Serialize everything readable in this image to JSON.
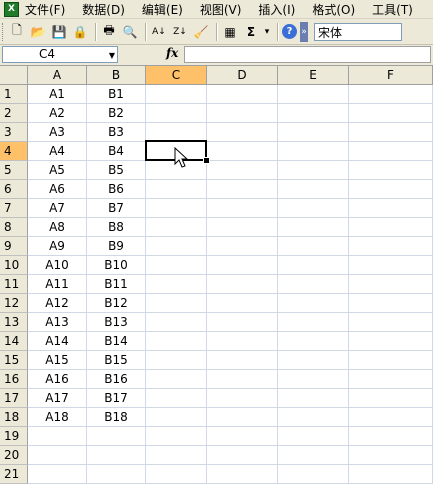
{
  "menu": {
    "app_icon": "X",
    "items": [
      "文件(F)",
      "数据(D)",
      "编辑(E)",
      "视图(V)",
      "插入(I)",
      "格式(O)",
      "工具(T)"
    ]
  },
  "toolbar": {
    "buttons": [
      {
        "name": "new-icon",
        "glyph": "🗋"
      },
      {
        "name": "open-icon",
        "glyph": "📂"
      },
      {
        "name": "save-icon",
        "glyph": "💾"
      },
      {
        "name": "permission-icon",
        "glyph": "🔒"
      },
      {
        "name": "print-icon",
        "glyph": "🖶"
      },
      {
        "name": "print-preview-icon",
        "glyph": "🔍"
      },
      {
        "name": "sort-ascending-icon",
        "glyph": "A↓"
      },
      {
        "name": "sort-descending-icon",
        "glyph": "Z↓"
      },
      {
        "name": "clear-icon",
        "glyph": "🧹"
      },
      {
        "name": "chart-wizard-icon",
        "glyph": "▦"
      },
      {
        "name": "autosum-icon",
        "glyph": "Σ"
      },
      {
        "name": "autosum-dropdown-icon",
        "glyph": "▾"
      },
      {
        "name": "help-icon",
        "glyph": "?"
      },
      {
        "name": "toolbar-options-icon",
        "glyph": "»"
      }
    ],
    "font_name": "宋体"
  },
  "formula_bar": {
    "name_box": "C4",
    "fx_label": "fx",
    "formula": ""
  },
  "columns": [
    "A",
    "B",
    "C",
    "D",
    "E",
    "F"
  ],
  "selected_column": "C",
  "selected_row": 4,
  "rows": [
    {
      "num": "1",
      "a": "A1",
      "b": "B1"
    },
    {
      "num": "2",
      "a": "A2",
      "b": "B2"
    },
    {
      "num": "3",
      "a": "A3",
      "b": "B3"
    },
    {
      "num": "4",
      "a": "A4",
      "b": "B4"
    },
    {
      "num": "5",
      "a": "A5",
      "b": "B5"
    },
    {
      "num": "6",
      "a": "A6",
      "b": "B6"
    },
    {
      "num": "7",
      "a": "A7",
      "b": "B7"
    },
    {
      "num": "8",
      "a": "A8",
      "b": "B8"
    },
    {
      "num": "9",
      "a": "A9",
      "b": "B9"
    },
    {
      "num": "10",
      "a": "A10",
      "b": "B10"
    },
    {
      "num": "11",
      "a": "A11",
      "b": "B11"
    },
    {
      "num": "12",
      "a": "A12",
      "b": "B12"
    },
    {
      "num": "13",
      "a": "A13",
      "b": "B13"
    },
    {
      "num": "14",
      "a": "A14",
      "b": "B14"
    },
    {
      "num": "15",
      "a": "A15",
      "b": "B15"
    },
    {
      "num": "16",
      "a": "A16",
      "b": "B16"
    },
    {
      "num": "17",
      "a": "A17",
      "b": "B17"
    },
    {
      "num": "18",
      "a": "A18",
      "b": "B18"
    },
    {
      "num": "19",
      "a": "",
      "b": ""
    },
    {
      "num": "20",
      "a": "",
      "b": ""
    },
    {
      "num": "21",
      "a": "",
      "b": ""
    }
  ]
}
